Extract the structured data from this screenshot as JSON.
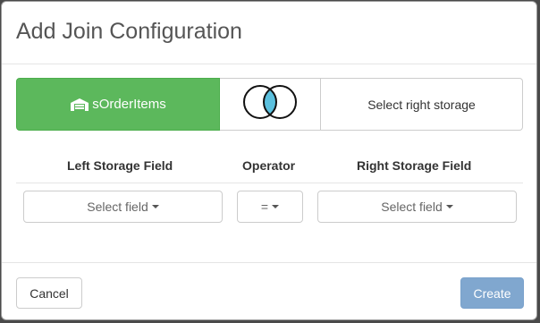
{
  "dialog": {
    "title": "Add Join Configuration",
    "left_storage": {
      "label": "sOrderItems",
      "icon": "warehouse-icon",
      "color": "#5cb85c"
    },
    "join_type": {
      "icon": "inner-join-venn-icon",
      "highlight_color": "#5bc0de"
    },
    "right_storage": {
      "label": "Select right storage"
    },
    "columns": {
      "left_field": "Left Storage Field",
      "operator": "Operator",
      "right_field": "Right Storage Field"
    },
    "row": {
      "left_select": "Select field",
      "operator_select": "=",
      "right_select": "Select field"
    },
    "footer": {
      "cancel_label": "Cancel",
      "create_label": "Create",
      "create_color": "#80a7cf"
    }
  }
}
